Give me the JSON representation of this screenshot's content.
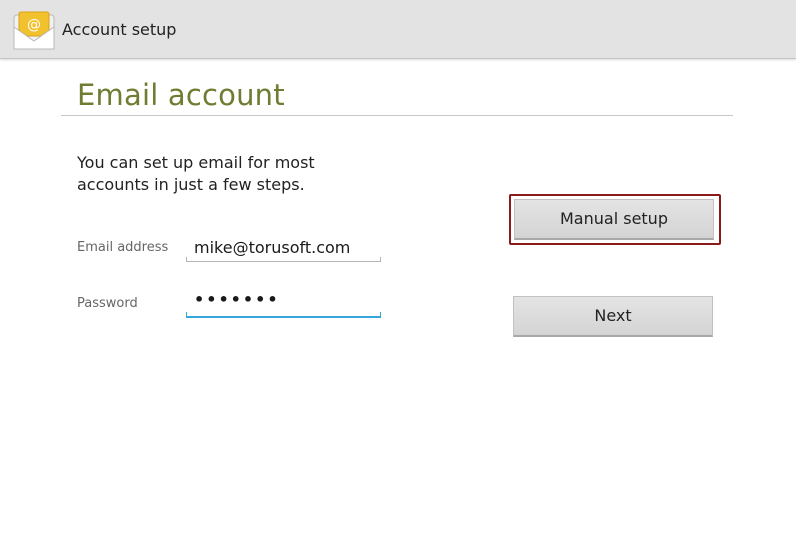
{
  "actionbar": {
    "title": "Account setup",
    "icon": "email-app-icon"
  },
  "page": {
    "title": "Email account",
    "intro": "You can set up email for most accounts in just a few steps."
  },
  "form": {
    "email": {
      "label": "Email address",
      "value": "mike@torusoft.com"
    },
    "password": {
      "label": "Password",
      "value": "•••••••"
    }
  },
  "buttons": {
    "manual_setup": "Manual setup",
    "next": "Next"
  },
  "colors": {
    "title_green": "#6f7d33",
    "focus_blue": "#36a5d9",
    "highlight_red": "#8b1a1a"
  }
}
